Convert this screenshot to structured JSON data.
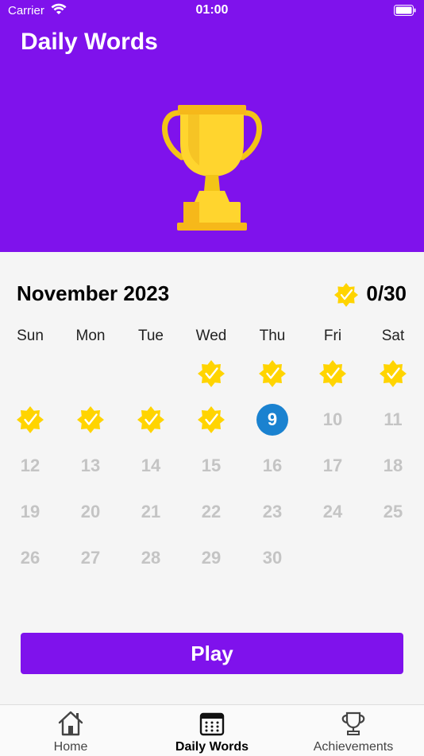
{
  "status": {
    "carrier": "Carrier",
    "time": "01:00"
  },
  "header": {
    "title": "Daily Words"
  },
  "calendar": {
    "month_label": "November 2023",
    "progress": "0/30",
    "weekdays": [
      "Sun",
      "Mon",
      "Tue",
      "Wed",
      "Thu",
      "Fri",
      "Sat"
    ],
    "first_weekday_index": 3,
    "days_in_month": 30,
    "completed_days": [
      1,
      2,
      3,
      4,
      5,
      6,
      7,
      8
    ],
    "today": 9
  },
  "play_label": "Play",
  "tabs": [
    {
      "label": "Home",
      "icon": "home-icon",
      "active": false
    },
    {
      "label": "Daily Words",
      "icon": "calendar-icon",
      "active": true
    },
    {
      "label": "Achievements",
      "icon": "trophy-icon",
      "active": false
    }
  ],
  "colors": {
    "brand": "#7f12ec",
    "today": "#1a82d0",
    "badge": "#ffd400"
  }
}
